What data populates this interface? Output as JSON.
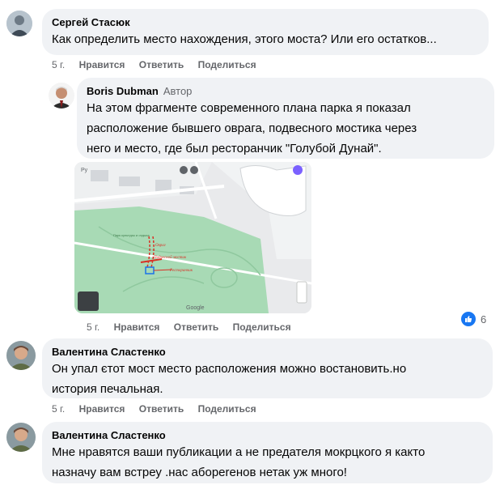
{
  "colors": {
    "bubble": "#f0f2f5",
    "meta": "#65676b",
    "like": "#1877f2",
    "map_park": "#a8dab5",
    "map_route": "#d93025"
  },
  "comments": [
    {
      "author": "Сергей Стасюк",
      "lines": [
        "Как определить место нахождения, этого моста? Или его остатков..."
      ],
      "actions": {
        "time": "5 г.",
        "like": "Нравится",
        "reply": "Ответить",
        "share": "Поделиться"
      }
    },
    {
      "author": "Boris Dubman",
      "badge": "Автор",
      "lines": [
        "На этом фрагменте современного плана парка я показал",
        "расположение бывшего оврага, подвесного мостика через",
        "него и место, где был ресторанчик \"Голубой Дунай\"."
      ],
      "actions": {
        "time": "5 г.",
        "like": "Нравится",
        "reply": "Ответить",
        "share": "Поделиться"
      },
      "reactions": {
        "icon": "like-icon",
        "count": "6"
      },
      "map": {
        "labels": [
          "Ру",
          "Парк культуры и отдыха",
          "Овраг",
          "Подвесной мостик",
          "Ресторанчик",
          "Google"
        ]
      }
    },
    {
      "author": "Валентина Сластенко",
      "lines": [
        "Он упал єтот мост место расположения можно востановить.но",
        "история печальная."
      ],
      "actions": {
        "time": "5 г.",
        "like": "Нравится",
        "reply": "Ответить",
        "share": "Поделиться"
      }
    },
    {
      "author": "Валентина Сластенко",
      "lines": [
        "Мне нравятся ваши публикации а не предателя мокрцкого я както",
        "назначу вам встреу .нас абореrенов нетак уж много!"
      ],
      "actions": {
        "time": "5 г.",
        "like": "Нравится",
        "reply": "Ответить",
        "share": "Поделиться"
      }
    }
  ]
}
